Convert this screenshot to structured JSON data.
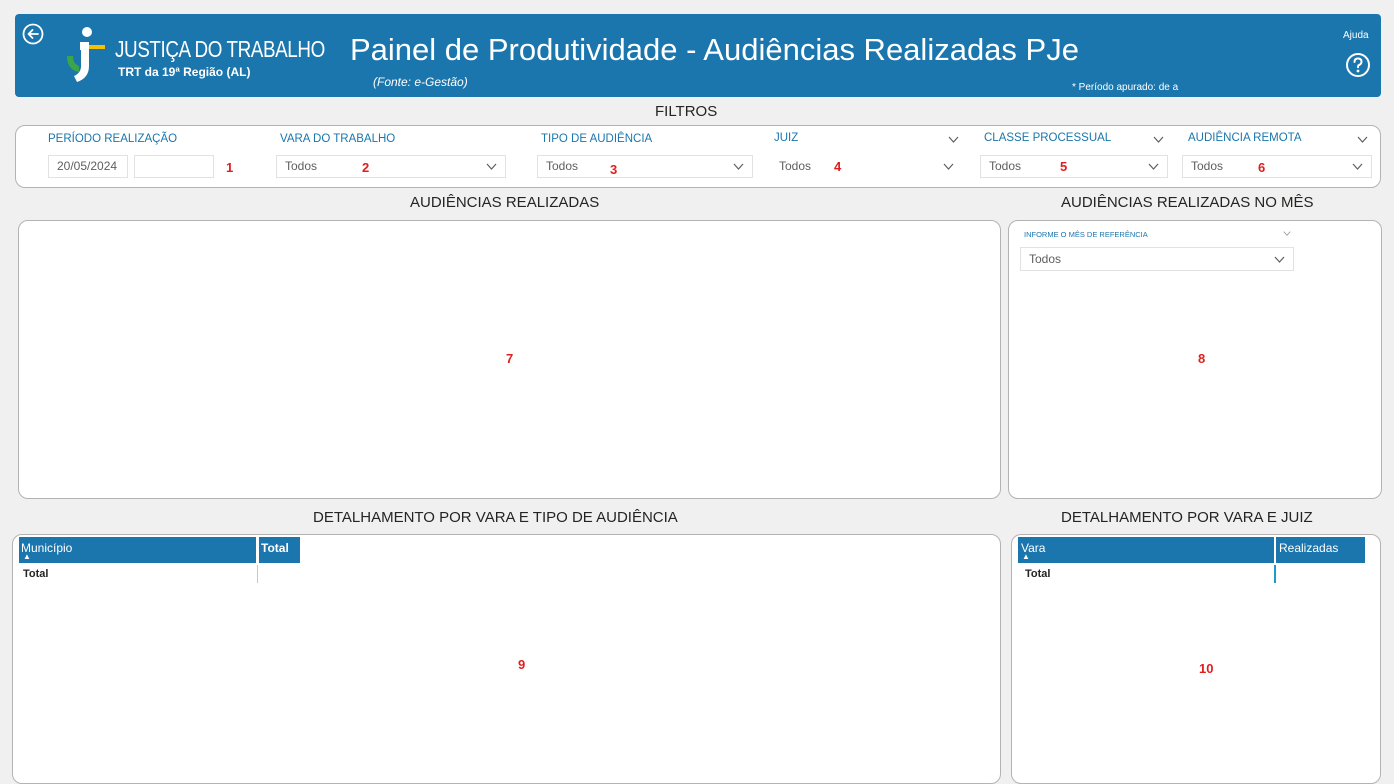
{
  "header": {
    "logo_title": "JUSTIÇA DO TRABALHO",
    "logo_subtitle": "TRT da 19ª Região (AL)",
    "title": "Painel de Produtividade - Audiências Realizadas PJe",
    "source": "(Fonte: e-Gestão)",
    "period": "* Período apurado: de  a",
    "help_label": "Ajuda",
    "accent_color": "#1a76ad"
  },
  "filters": {
    "section_title": "FILTROS",
    "periodo": {
      "label": "PERÍODO REALIZAÇÃO",
      "start": "20/05/2024",
      "end": "",
      "marker": "1"
    },
    "vara": {
      "label": "VARA DO TRABALHO",
      "value": "Todos",
      "marker": "2"
    },
    "tipo": {
      "label": "TIPO DE AUDIÊNCIA",
      "value": "Todos",
      "marker": "3"
    },
    "juiz": {
      "label": "JUIZ",
      "value": "Todos",
      "marker": "4"
    },
    "classe": {
      "label": "CLASSE PROCESSUAL",
      "value": "Todos",
      "marker": "5"
    },
    "remota": {
      "label": "AUDIÊNCIA REMOTA",
      "value": "Todos",
      "marker": "6"
    }
  },
  "audiencias": {
    "title": "AUDIÊNCIAS REALIZADAS",
    "marker": "7"
  },
  "mes": {
    "title": "AUDIÊNCIAS REALIZADAS NO MÊS",
    "slicer_label": "INFORME O MÊS DE REFERÊNCIA",
    "slicer_value": "Todos",
    "marker": "8"
  },
  "detalhe_tipo": {
    "title": "DETALHAMENTO POR VARA E TIPO DE AUDIÊNCIA",
    "columns": [
      "Município",
      "Total"
    ],
    "total_row": "Total",
    "marker": "9"
  },
  "detalhe_juiz": {
    "title": "DETALHAMENTO POR VARA E JUIZ",
    "columns": [
      "Vara",
      "Realizadas"
    ],
    "total_row": "Total",
    "marker": "10"
  }
}
